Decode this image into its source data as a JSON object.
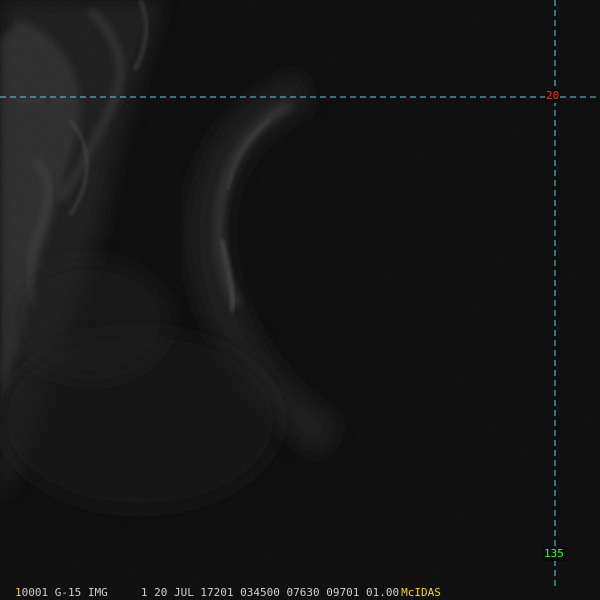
{
  "colors": {
    "grid_line": "#5fd3e6",
    "lat_label": "#ff2a2a",
    "lon_label": "#33ff33",
    "footer_text": "#d0d0d0",
    "footer_accent": "#ffd700",
    "background": "#0a0a0a"
  },
  "gridlines": {
    "latitude_label": "20",
    "longitude_label": "135"
  },
  "footer": {
    "frame_number": "1",
    "header_text": "0001 G-15 IMG     1 20 JUL 17201 034500 07630 09701 01.00",
    "brand": "McIDAS"
  }
}
